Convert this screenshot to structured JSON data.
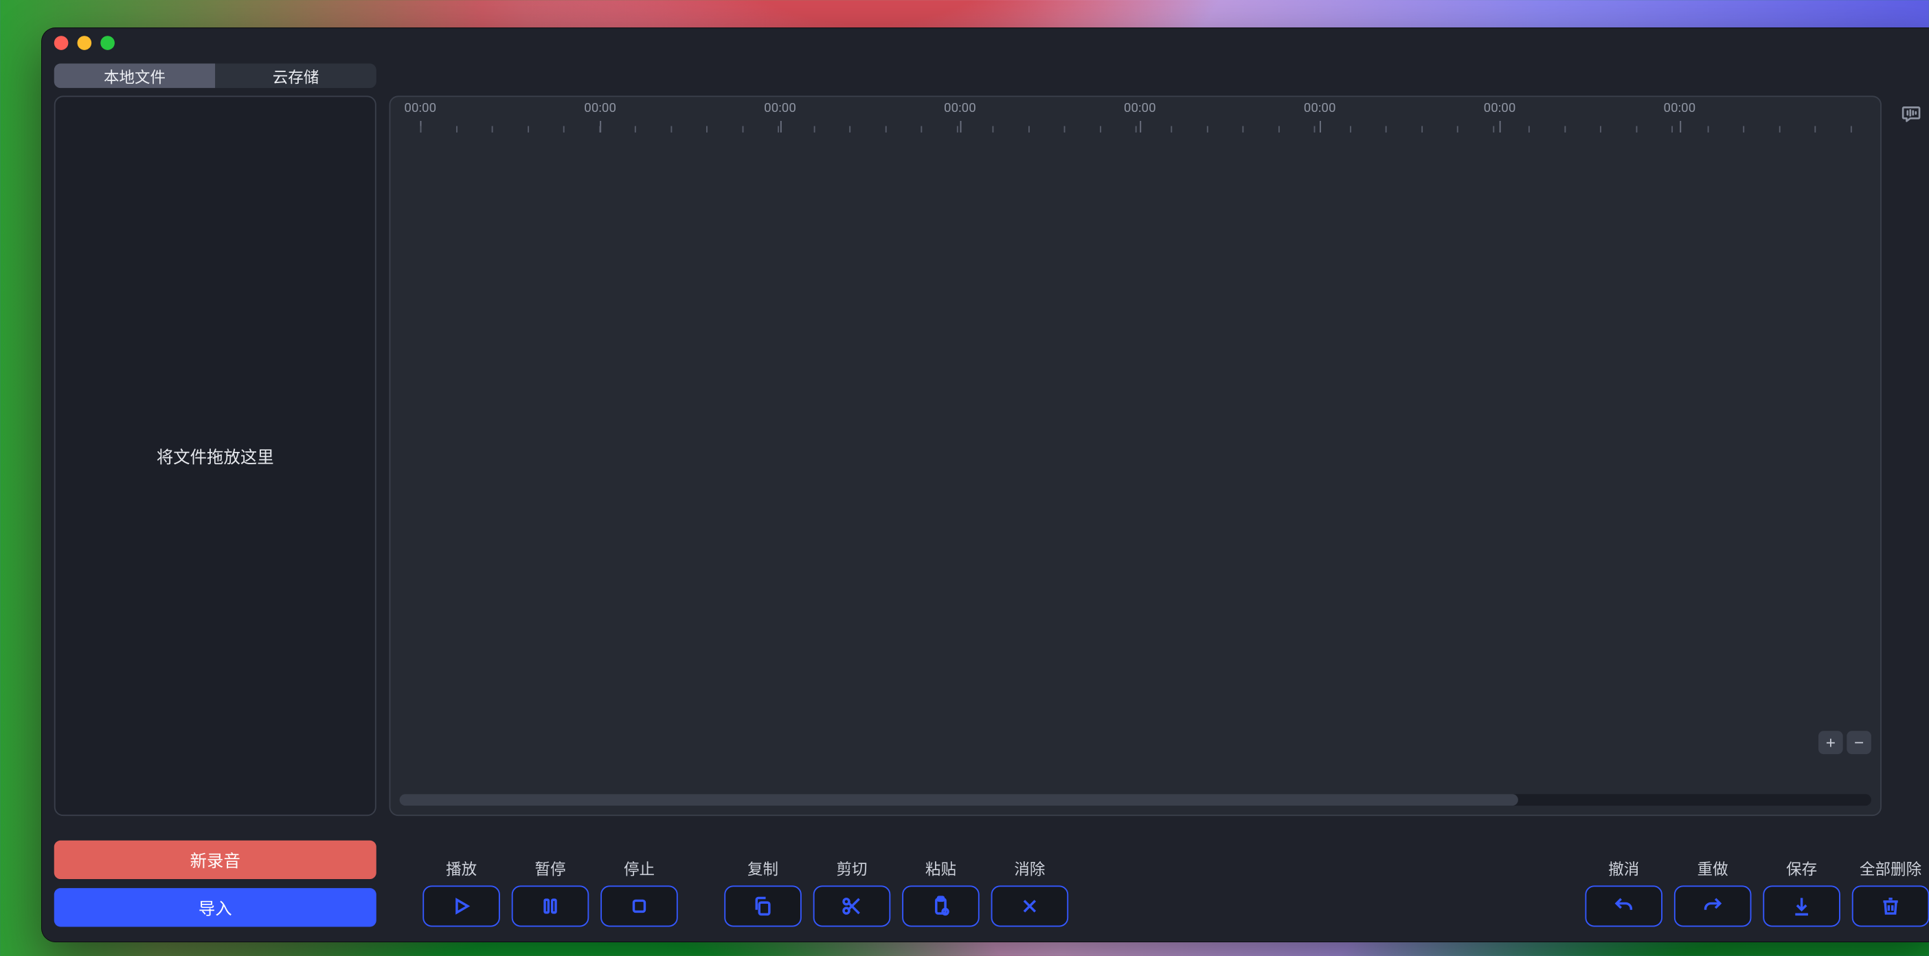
{
  "tabs": {
    "local": "本地文件",
    "cloud": "云存储",
    "active": "local"
  },
  "sidebar": {
    "drop_hint": "将文件拖放这里",
    "record_label": "新录音",
    "import_label": "导入"
  },
  "timeline": {
    "ruler_labels": [
      "00:00",
      "00:00",
      "00:00",
      "00:00",
      "00:00",
      "00:00",
      "00:00",
      "00:00"
    ],
    "major_ticks": 8,
    "minor_per_major": 5
  },
  "zoom": {
    "in": "+",
    "out": "−"
  },
  "toolbar": {
    "play": "播放",
    "pause": "暂停",
    "stop": "停止",
    "copy": "复制",
    "cut": "剪切",
    "paste": "粘贴",
    "clear": "消除",
    "undo": "撤消",
    "redo": "重做",
    "save": "保存",
    "delete_all": "全部删除"
  }
}
